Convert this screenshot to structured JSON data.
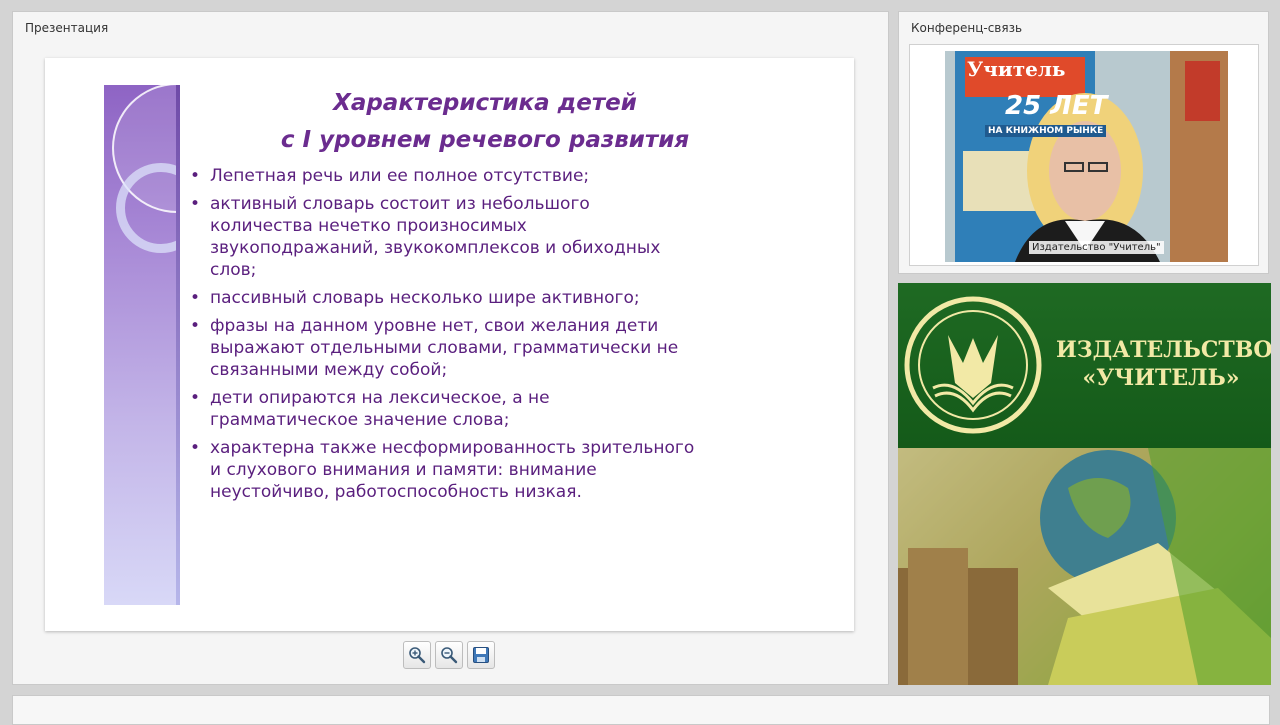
{
  "presentation": {
    "title": "Презентация",
    "slide": {
      "heading_line1": "Характеристика детей",
      "heading_line2": "с I уровнем речевого развития",
      "bullets": [
        "Лепетная речь или ее полное отсутствие;",
        " активный словарь состоит из небольшого\nколичества нечетко произносимых\nзвукоподражаний, звукокомплексов и обиходных\nслов;",
        " пассивный словарь несколько шире активного;",
        "фразы на данном уровне нет, свои желания дети\nвыражают отдельными словами, грамматически не\nсвязанными между собой;",
        " дети опираются  на лексическое, а не\nграмматическое значение слова;",
        " характерна также несформированность зрительного\nи слухового внимания и памяти: внимание\nнеустойчиво, работоспособность низкая."
      ]
    },
    "toolbar": {
      "zoom_in_icon": "zoom-in-icon",
      "zoom_out_icon": "zoom-out-icon",
      "save_icon": "floppy-disk-icon"
    }
  },
  "conference": {
    "title": "Конференц-связь",
    "video_label": "Издательство \"Учитель\"",
    "poster_text": {
      "brand": "Учитель",
      "years": "25 ЛЕТ",
      "subtitle": "НА КНИЖНОМ РЫНКЕ"
    }
  },
  "banner": {
    "name_line1": "ИЗДАТЕЛЬСТВО",
    "name_line2": "«УЧИТЕЛЬ»",
    "colors": {
      "green": "#1f6a23",
      "gold": "#f2e9a6"
    }
  }
}
